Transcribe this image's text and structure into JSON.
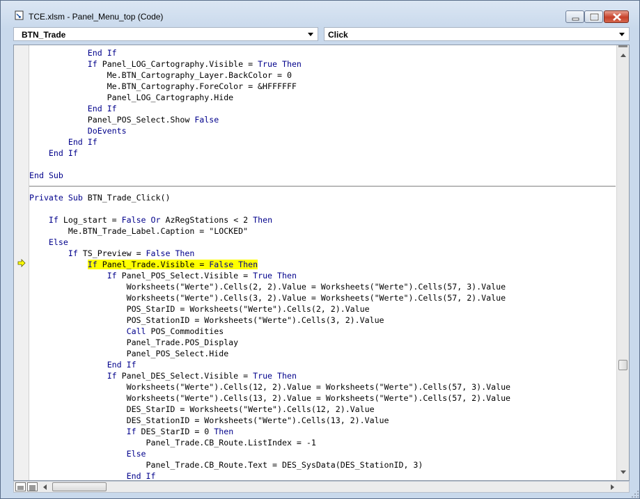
{
  "window": {
    "title": "TCE.xlsm - Panel_Menu_top (Code)"
  },
  "object_combo": {
    "value": "BTN_Trade"
  },
  "procedure_combo": {
    "value": "Click"
  },
  "code_lines": [
    "            End If",
    "            If Panel_LOG_Cartography.Visible = True Then",
    "                Me.BTN_Cartography_Layer.BackColor = 0",
    "                Me.BTN_Cartography.ForeColor = &HFFFFFF",
    "                Panel_LOG_Cartography.Hide",
    "            End If",
    "            Panel_POS_Select.Show False",
    "            DoEvents",
    "        End If",
    "    End If",
    "",
    "End Sub",
    "",
    "Private Sub BTN_Trade_Click()",
    "",
    "    If Log_start = False Or AzRegStations < 2 Then",
    "        Me.BTN_Trade_Label.Caption = \"LOCKED\"",
    "    Else",
    "        If TS_Preview = False Then",
    "            If Panel_Trade.Visible = False Then",
    "                If Panel_POS_Select.Visible = True Then",
    "                    Worksheets(\"Werte\").Cells(2, 2).Value = Worksheets(\"Werte\").Cells(57, 3).Value",
    "                    Worksheets(\"Werte\").Cells(3, 2).Value = Worksheets(\"Werte\").Cells(57, 2).Value",
    "                    POS_StarID = Worksheets(\"Werte\").Cells(2, 2).Value",
    "                    POS_StationID = Worksheets(\"Werte\").Cells(3, 2).Value",
    "                    Call POS_Commodities",
    "                    Panel_Trade.POS_Display",
    "                    Panel_POS_Select.Hide",
    "                End If",
    "                If Panel_DES_Select.Visible = True Then",
    "                    Worksheets(\"Werte\").Cells(12, 2).Value = Worksheets(\"Werte\").Cells(57, 3).Value",
    "                    Worksheets(\"Werte\").Cells(13, 2).Value = Worksheets(\"Werte\").Cells(57, 2).Value",
    "                    DES_StarID = Worksheets(\"Werte\").Cells(12, 2).Value",
    "                    DES_StationID = Worksheets(\"Werte\").Cells(13, 2).Value",
    "                    If DES_StarID = 0 Then",
    "                        Panel_Trade.CB_Route.ListIndex = -1",
    "                    Else",
    "                        Panel_Trade.CB_Route.Text = DES_SysData(DES_StationID, 3)",
    "                    End If"
  ],
  "highlighted_line": 19,
  "separator_after_line": 11,
  "keywords": [
    "Private",
    "Sub",
    "End",
    "If",
    "Then",
    "Else",
    "True",
    "False",
    "Or",
    "Call",
    "DoEvents"
  ],
  "colors": {
    "keyword": "#00008b",
    "highlight": "#ffff00",
    "text": "#000000"
  },
  "icons": {
    "title": "vba-module-icon",
    "minimize": "minimize-icon",
    "maximize": "maximize-icon",
    "close": "close-icon",
    "execution_marker": "execution-arrow-icon"
  }
}
